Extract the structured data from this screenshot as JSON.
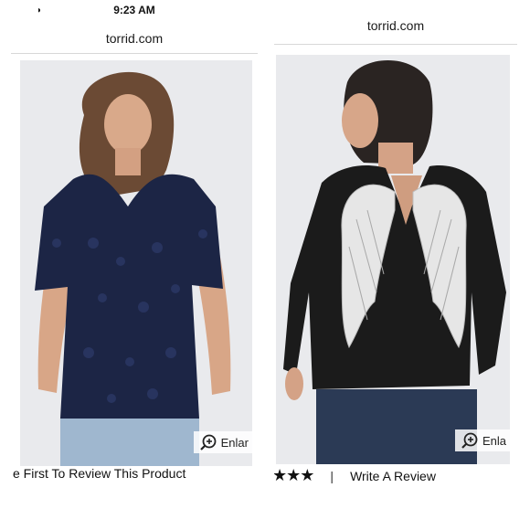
{
  "left": {
    "status_time": "9:23 AM",
    "url": "torrid.com",
    "enlarge_label": "Enlar",
    "review_text": "e First To Review This Product"
  },
  "right": {
    "url": "torrid.com",
    "enlarge_label": "Enla",
    "rating_stars": "★★★",
    "separator": "|",
    "write_review_label": "Write A Review"
  },
  "colors": {
    "navy_top": "#1c2545",
    "black_sweater": "#1b1b1b",
    "wings": "#e6e6e6",
    "photo_bg": "#e9eaed"
  }
}
